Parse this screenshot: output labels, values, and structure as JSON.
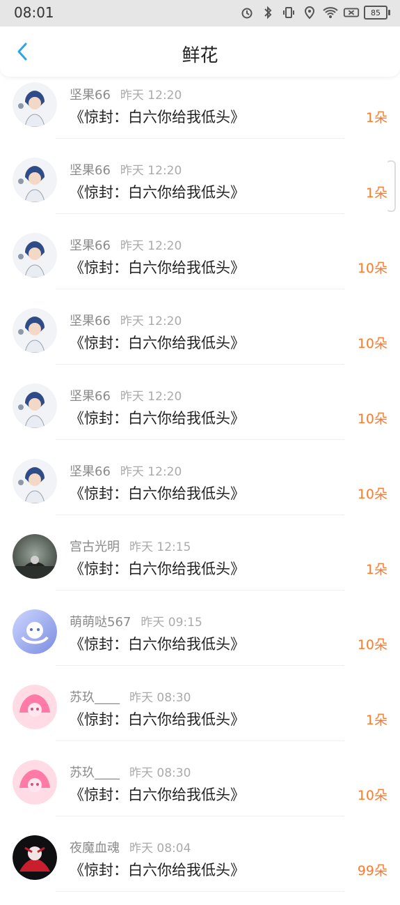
{
  "status_bar": {
    "time": "08:01",
    "icons": [
      "alarm-icon",
      "bluetooth-icon",
      "vibrate-icon",
      "location-icon",
      "wifi-icon",
      "sim-icon"
    ],
    "battery": "85"
  },
  "header": {
    "title": "鲜花"
  },
  "list": [
    {
      "user": "坚果66",
      "time": "昨天 12:20",
      "book": "《惊封：白六你给我低头》",
      "count": "1朵",
      "avatar": "a1"
    },
    {
      "user": "坚果66",
      "time": "昨天 12:20",
      "book": "《惊封：白六你给我低头》",
      "count": "1朵",
      "avatar": "a1"
    },
    {
      "user": "坚果66",
      "time": "昨天 12:20",
      "book": "《惊封：白六你给我低头》",
      "count": "10朵",
      "avatar": "a1"
    },
    {
      "user": "坚果66",
      "time": "昨天 12:20",
      "book": "《惊封：白六你给我低头》",
      "count": "10朵",
      "avatar": "a1"
    },
    {
      "user": "坚果66",
      "time": "昨天 12:20",
      "book": "《惊封：白六你给我低头》",
      "count": "10朵",
      "avatar": "a1"
    },
    {
      "user": "坚果66",
      "time": "昨天 12:20",
      "book": "《惊封：白六你给我低头》",
      "count": "10朵",
      "avatar": "a1"
    },
    {
      "user": "宫古光明",
      "time": "昨天 12:15",
      "book": "《惊封：白六你给我低头》",
      "count": "1朵",
      "avatar": "a2"
    },
    {
      "user": "萌萌哒567",
      "time": "昨天 09:15",
      "book": "《惊封：白六你给我低头》",
      "count": "10朵",
      "avatar": "a3"
    },
    {
      "user": "苏玖____",
      "time": "昨天 08:30",
      "book": "《惊封：白六你给我低头》",
      "count": "1朵",
      "avatar": "a4"
    },
    {
      "user": "苏玖____",
      "time": "昨天 08:30",
      "book": "《惊封：白六你给我低头》",
      "count": "10朵",
      "avatar": "a4"
    },
    {
      "user": "夜魔血魂",
      "time": "昨天 08:04",
      "book": "《惊封：白六你给我低头》",
      "count": "99朵",
      "avatar": "a5"
    }
  ],
  "colors": {
    "accent": "#2aa7e6",
    "count": "#ff7a2d",
    "name": "#8a8a8a",
    "time": "#aaaaaa"
  }
}
